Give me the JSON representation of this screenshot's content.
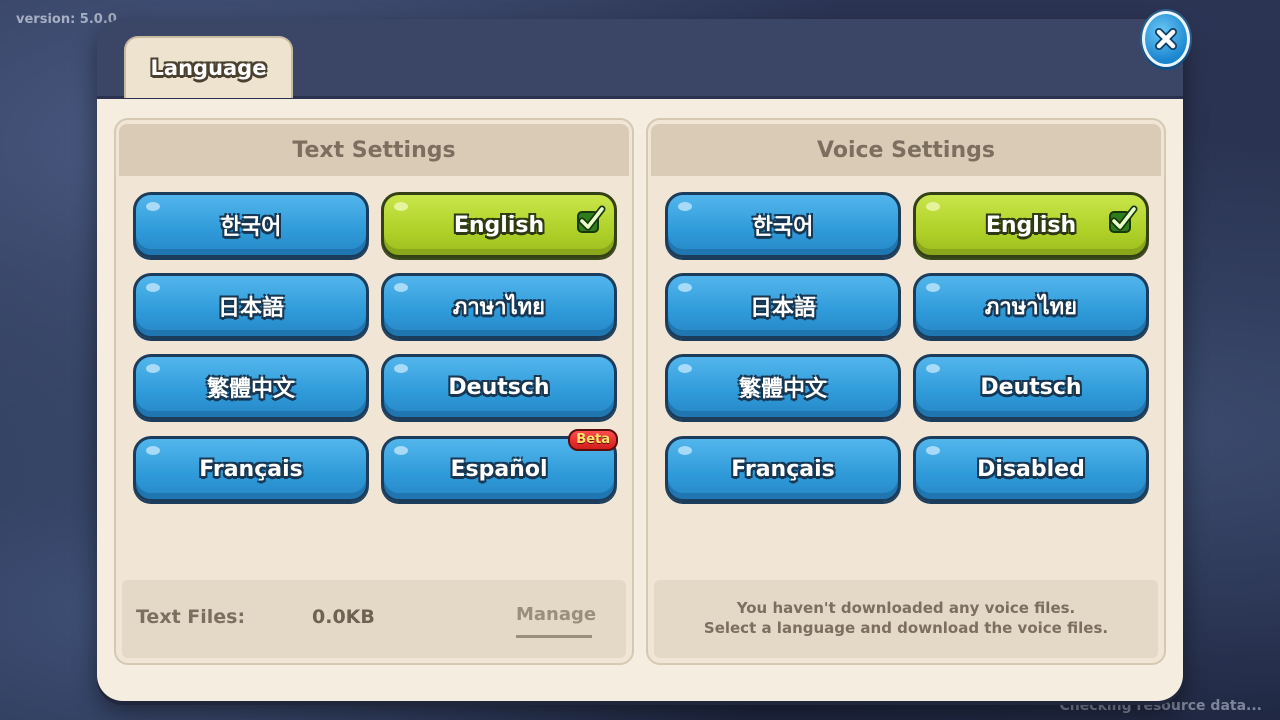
{
  "version_text": "version: 5.0.0",
  "status_text": "Checking resource data...",
  "tab": {
    "label": "Language"
  },
  "text_settings": {
    "title": "Text Settings",
    "options": [
      {
        "label": "한국어",
        "selected": false
      },
      {
        "label": "English",
        "selected": true
      },
      {
        "label": "日本語",
        "selected": false
      },
      {
        "label": "ภาษาไทย",
        "selected": false
      },
      {
        "label": "繁體中文",
        "selected": false
      },
      {
        "label": "Deutsch",
        "selected": false
      },
      {
        "label": "Français",
        "selected": false
      },
      {
        "label": "Español",
        "selected": false,
        "badge": "Beta"
      }
    ],
    "footer": {
      "label": "Text Files:",
      "size": "0.0KB",
      "manage": "Manage"
    }
  },
  "voice_settings": {
    "title": "Voice Settings",
    "options": [
      {
        "label": "한국어",
        "selected": false
      },
      {
        "label": "English",
        "selected": true
      },
      {
        "label": "日本語",
        "selected": false
      },
      {
        "label": "ภาษาไทย",
        "selected": false
      },
      {
        "label": "繁體中文",
        "selected": false
      },
      {
        "label": "Deutsch",
        "selected": false
      },
      {
        "label": "Français",
        "selected": false
      },
      {
        "label": "Disabled",
        "selected": false
      }
    ],
    "message_line1": "You haven't downloaded any voice files.",
    "message_line2": "Select a language and download the voice files."
  },
  "icons": {
    "close": "close-icon",
    "check": "checkmark-icon"
  },
  "colors": {
    "selected": "#b5d52c",
    "button": "#3aa4e0",
    "close": "#2b9be0",
    "beta": "#e02a2a"
  }
}
